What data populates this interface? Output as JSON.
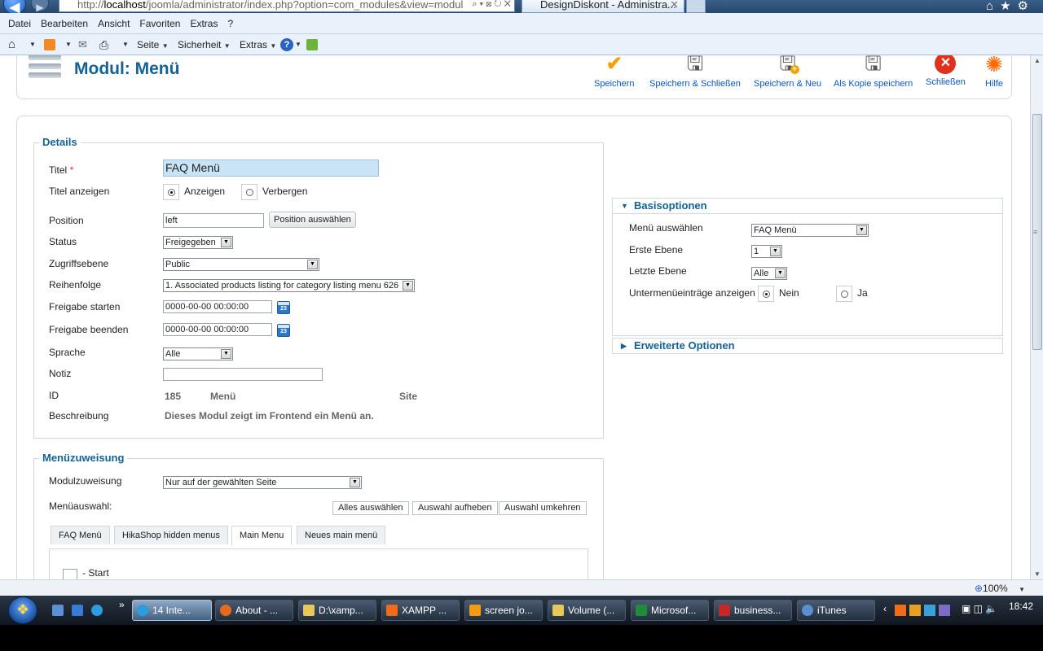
{
  "browser": {
    "url_prefix": "http://",
    "url_host": "localhost",
    "url_rest": "/joomla/administrator/index.php?option=com_modules&view=modul",
    "tab_title": "DesignDiskont - Administra...",
    "menu": [
      "Datei",
      "Bearbeiten",
      "Ansicht",
      "Favoriten",
      "Extras",
      "?"
    ],
    "cmd": {
      "page": "Seite",
      "security": "Sicherheit",
      "extras": "Extras"
    }
  },
  "header": {
    "title": "Modul: Menü",
    "buttons": {
      "save": "Speichern",
      "save_close": "Speichern & Schließen",
      "save_new": "Speichern & Neu",
      "save_copy": "Als Kopie speichern",
      "close": "Schließen",
      "help": "Hilfe"
    }
  },
  "details": {
    "legend": "Details",
    "title_label": "Titel",
    "title_required": "*",
    "title_value": "FAQ Menü",
    "show_title_label": "Titel anzeigen",
    "show_option": "Anzeigen",
    "hide_option": "Verbergen",
    "position_label": "Position",
    "position_value": "left",
    "position_button": "Position auswählen",
    "status_label": "Status",
    "status_value": "Freigegeben",
    "access_label": "Zugriffsebene",
    "access_value": "Public",
    "order_label": "Reihenfolge",
    "order_value": "1. Associated products listing for category listing menu 626",
    "publish_up_label": "Freigabe starten",
    "publish_up_value": "0000-00-00 00:00:00",
    "publish_down_label": "Freigabe beenden",
    "publish_down_value": "0000-00-00 00:00:00",
    "calendar_day": "23",
    "language_label": "Sprache",
    "language_value": "Alle",
    "note_label": "Notiz",
    "note_value": "",
    "id_label": "ID",
    "id_value": "185",
    "id_type": "Menü",
    "id_client": "Site",
    "description_label": "Beschreibung",
    "description_value": "Dieses Modul zeigt im Frontend ein Menü an."
  },
  "basic_options": {
    "heading": "Basisoptionen",
    "menu_label": "Menü auswählen",
    "menu_value": "FAQ Menü",
    "start_level_label": "Erste Ebene",
    "start_level_value": "1",
    "end_level_label": "Letzte Ebene",
    "end_level_value": "Alle",
    "show_sub_label": "Untermenüeinträge anzeigen",
    "show_sub_no": "Nein",
    "show_sub_yes": "Ja"
  },
  "advanced_options": {
    "heading": "Erweiterte Optionen"
  },
  "menu_assignment": {
    "legend": "Menüzuweisung",
    "assignment_label": "Modulzuweisung",
    "assignment_value": "Nur auf der gewählten Seite",
    "selection_label": "Menüauswahl:",
    "select_all": "Alles auswählen",
    "select_none": "Auswahl aufheben",
    "select_invert": "Auswahl umkehren",
    "tabs": [
      "FAQ Menü",
      "HikaShop hidden menus",
      "Main Menu",
      "Neues main menü"
    ],
    "active_tab": "Main Menu",
    "first_item": "- Start"
  },
  "statusbar": {
    "zoom": "100%"
  },
  "taskbar": {
    "tasks": [
      "14 Inte...",
      "About - ...",
      "D:\\xamp...",
      "XAMPP ...",
      "screen jo...",
      "Volume (...",
      "Microsof...",
      "business...",
      "iTunes"
    ],
    "clock": "18:42"
  }
}
